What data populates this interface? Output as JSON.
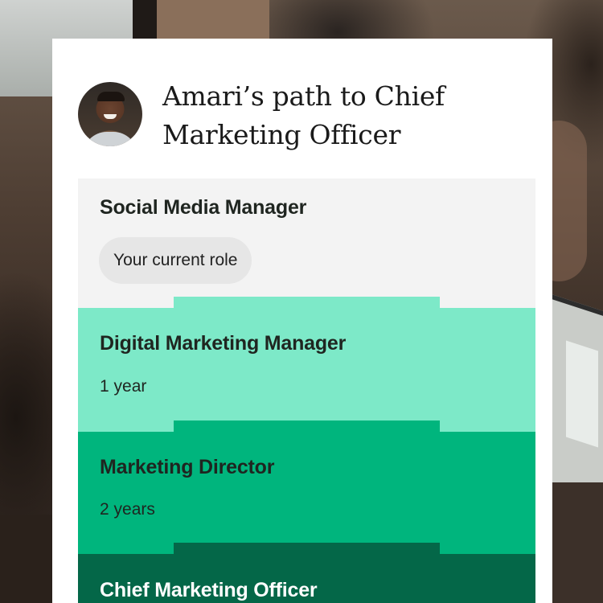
{
  "header": {
    "title": "Amari’s path to Chief Marketing Officer"
  },
  "colors": {
    "current": "#f3f3f3",
    "step1": "#7de9c8",
    "step2": "#00b57d",
    "step3": "#046748"
  },
  "path": {
    "current": {
      "role": "Social Media Manager",
      "badge": "Your current role"
    },
    "steps": [
      {
        "role": "Digital Marketing Manager",
        "duration": "1 year"
      },
      {
        "role": "Marketing Director",
        "duration": "2 years"
      },
      {
        "role": "Chief Marketing Officer"
      }
    ]
  }
}
